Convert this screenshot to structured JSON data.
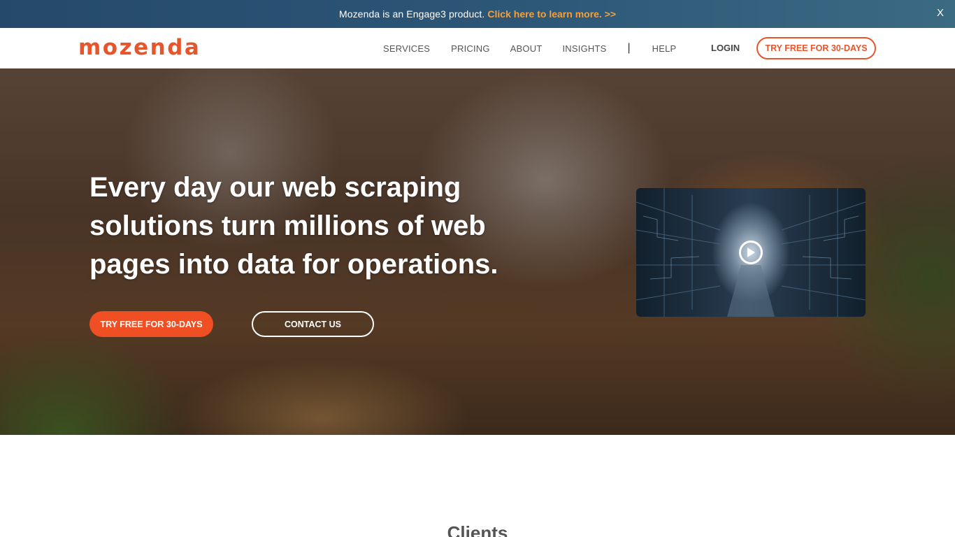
{
  "announcement": {
    "text": "Mozenda is an Engage3 product.",
    "link_text": "Click here to learn more. >>",
    "close_label": "X"
  },
  "nav": {
    "logo": "mozenda",
    "items": [
      {
        "label": "SERVICES"
      },
      {
        "label": "PRICING"
      },
      {
        "label": "ABOUT"
      },
      {
        "label": "INSIGHTS"
      },
      {
        "label": "HELP"
      }
    ],
    "separator": "|",
    "login": "LOGIN",
    "cta": "TRY FREE FOR 30-DAYS"
  },
  "hero": {
    "title": "Every day our web scraping solutions turn millions of web pages into data for operations.",
    "primary_cta": "TRY FREE FOR 30-DAYS",
    "secondary_cta": "CONTACT US",
    "video_icon": "play-circle-icon"
  },
  "clients": {
    "heading": "Clients"
  },
  "colors": {
    "brand_orange": "#e8552a",
    "cta_fill": "#f04e23",
    "announce_bg": "#2c5576",
    "link_accent": "#f5a03a"
  }
}
